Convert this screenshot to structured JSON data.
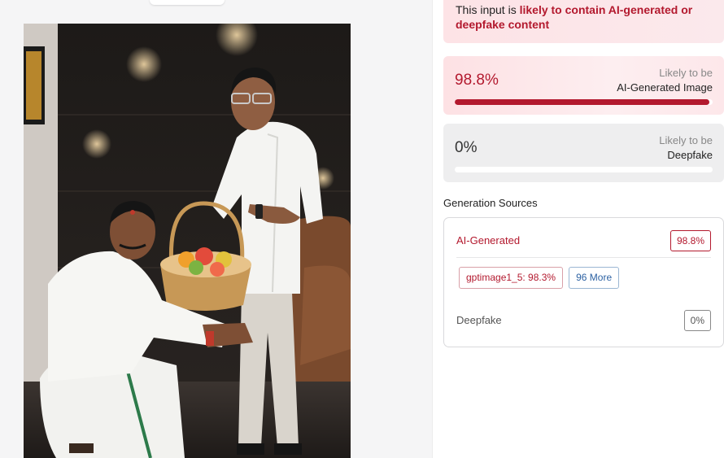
{
  "banner": {
    "prefix": "This input is ",
    "highlight": "likely to contain AI-generated or deepfake content"
  },
  "scores": {
    "ai": {
      "percent": "98.8%",
      "label_top": "Likely to be",
      "label_main": "AI-Generated Image",
      "fill_fraction": 0.988
    },
    "deepfake": {
      "percent": "0%",
      "label_top": "Likely to be",
      "label_main": "Deepfake",
      "fill_fraction": 0.0
    }
  },
  "sources": {
    "title": "Generation Sources",
    "ai": {
      "name": "AI-Generated",
      "badge": "98.8%"
    },
    "chips": {
      "model": "gptimage1_5: 98.3%",
      "more": "96 More"
    },
    "deepfake": {
      "name": "Deepfake",
      "badge": "0%"
    }
  },
  "colors": {
    "accent": "#b3192e",
    "link": "#2d62a3",
    "panel_bg": "#f5f5f6"
  }
}
